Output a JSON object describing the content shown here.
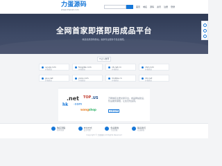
{
  "header": {
    "logo_main": "力蛋源码",
    "logo_sub": "www.zhenet.com",
    "search_placeholder": "",
    "nav": [
      "首页",
      "域名",
      "源码",
      "资讯",
      "注册",
      "登录"
    ]
  },
  "hero": {
    "title": "全网首家即搭即用成品平台",
    "subtitle": "精选优质源码整站，提供专业服务与售后保障。"
  },
  "tag": "IT达人推荐",
  "domains": [
    {
      "name": "uyuqi.com",
      "meta": "价格面议"
    },
    {
      "name": "fangdai.com",
      "meta": "价格面议"
    },
    {
      "name": "xb.net.cn",
      "meta": "价格面议"
    },
    {
      "name": "cbd.com",
      "meta": "价格面议"
    },
    {
      "name": "gou.net",
      "meta": "价格面议"
    },
    {
      "name": "yooo.com",
      "meta": "价格面议"
    },
    {
      "name": "mobile.cn",
      "meta": "价格面议"
    },
    {
      "name": "idc.net",
      "meta": "价格面议"
    }
  ],
  "promo": {
    "text": "万网域名注册交易平台，成品网站建设，售后服务保障，让您无忧运营。",
    "button": "立即咨询",
    "logos": {
      "net": ".net",
      "hk": "hk",
      "com": "·com",
      "top": "TOP",
      "us": ".US",
      "wang": "wang",
      "shop": "shop"
    }
  },
  "footer": {
    "features": [
      {
        "label": "购买流程",
        "desc": "简单快捷"
      },
      {
        "label": "支付方式",
        "desc": "安全可靠"
      },
      {
        "label": "售后服务",
        "desc": "专业保障"
      },
      {
        "label": "联系我们",
        "desc": "在线客服"
      }
    ],
    "copyright": "Copyright © 力蛋源码 All Rights Reserved"
  },
  "colors": {
    "brand_blue": "#1677d8",
    "hero_bg": "#3a4562"
  }
}
